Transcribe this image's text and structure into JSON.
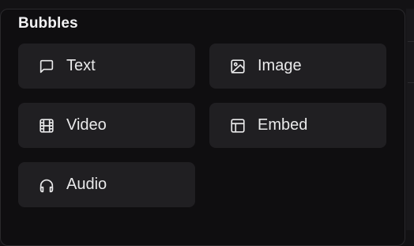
{
  "panel": {
    "title": "Bubbles",
    "items": [
      {
        "label": "Text",
        "icon": "message-square-icon"
      },
      {
        "label": "Image",
        "icon": "image-icon"
      },
      {
        "label": "Video",
        "icon": "film-icon"
      },
      {
        "label": "Embed",
        "icon": "layout-icon"
      },
      {
        "label": "Audio",
        "icon": "headphones-icon"
      }
    ]
  },
  "colors": {
    "panel_bg": "#0f0e10",
    "tile_bg": "#201f22",
    "text": "#e9e9ea"
  }
}
